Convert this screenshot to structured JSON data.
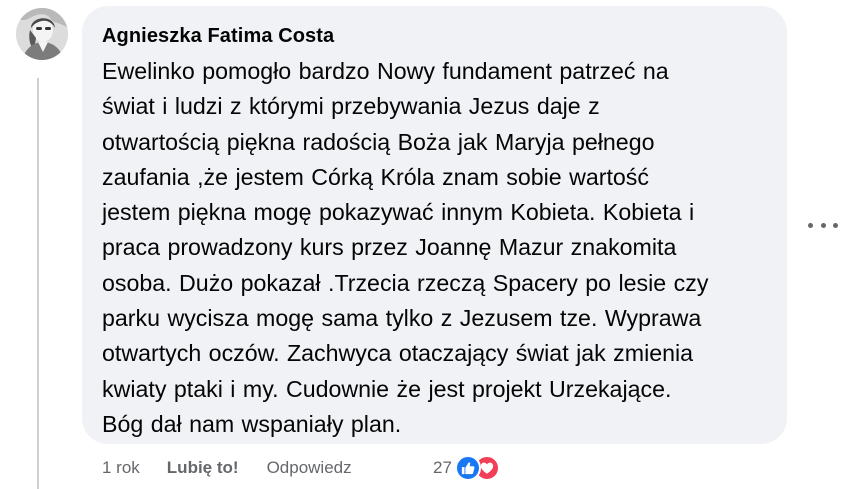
{
  "comment": {
    "author": "Agnieszka Fatima Costa",
    "lines": [
      "Ewelinko pomogło bardzo Nowy fundament patrzeć na",
      "świat i ludzi z którymi przebywania Jezus daje z",
      "otwartością piękna radością Boża jak Maryja pełnego",
      "zaufania ,że jestem Córką Króla znam sobie wartość",
      "jestem piękna mogę pokazywać innym Kobieta. Kobieta i",
      "praca prowadzony kurs przez Joannę Mazur znakomita",
      "osoba. Dużo pokazał .Trzecia rzeczą Spacery po lesie czy",
      "parku wycisza mogę sama tylko z Jezusem tze. Wyprawa",
      "otwartych oczów. Zachwyca otaczający świat jak zmienia",
      "kwiaty ptaki i my. Cudownie że jest projekt Urzekające.",
      "Bóg dał nam wspaniały plan."
    ]
  },
  "actions": {
    "time": "1 rok",
    "like_label": "Lubię to!",
    "reply_label": "Odpowiedz"
  },
  "reactions": {
    "count": "27",
    "icons": [
      "like-icon",
      "love-icon"
    ]
  },
  "colors": {
    "bubble": "#f0f2f5",
    "text": "#050505",
    "secondary": "#65676b",
    "like_blue": "#1877f2",
    "love_red": "#f33e58"
  }
}
